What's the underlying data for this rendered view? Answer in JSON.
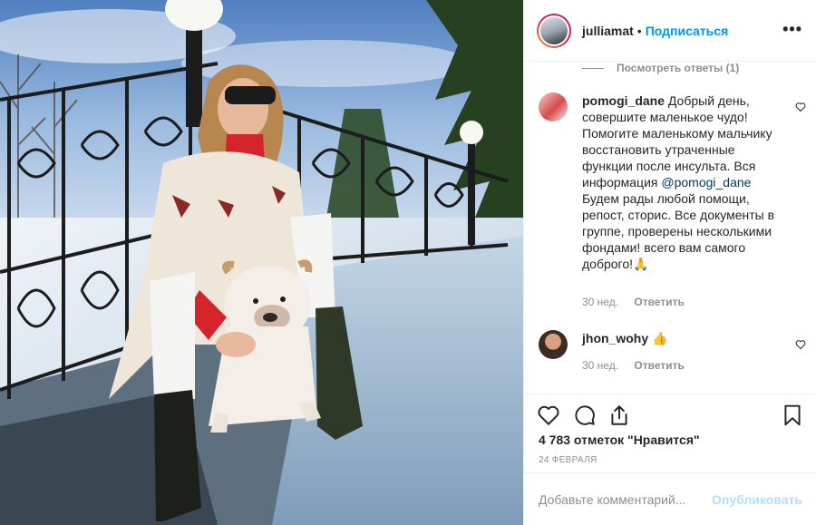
{
  "post": {
    "username": "julliamat",
    "separator": "•",
    "follow_label": "Подписаться",
    "more_icon": "more-horizontal-icon",
    "view_replies_label": "Посмотреть ответы (1)"
  },
  "comments": [
    {
      "username": "pomogi_dane",
      "text_before_link": " Добрый день, совершите маленькое чудо! Помогите маленькому мальчику восстановить утраченные функции после инсульта. Вся информация ",
      "link": "@pomogi_dane",
      "text_after_link": " Будем рады любой помощи, репост, сторис. Все документы в группе, проверены несколькими фондами! всего вам самого доброго!🙏",
      "time": "30 нед.",
      "reply_label": "Ответить"
    },
    {
      "username": "jhon_wohy",
      "text": " 👍",
      "time": "30 нед.",
      "reply_label": "Ответить"
    }
  ],
  "actions": {
    "like_icon": "heart-icon",
    "comment_icon": "comment-icon",
    "share_icon": "share-icon",
    "save_icon": "bookmark-icon"
  },
  "likes_text": "4 783 отметок \"Нравится\"",
  "date_text": "24 ФЕВРАЛЯ",
  "add_comment": {
    "placeholder": "Добавьте комментарий...",
    "publish_label": "Опубликовать"
  },
  "colors": {
    "accent": "#0095f6",
    "link": "#00376b",
    "muted": "#8e8e8e",
    "publish_disabled": "#b2dffc"
  }
}
